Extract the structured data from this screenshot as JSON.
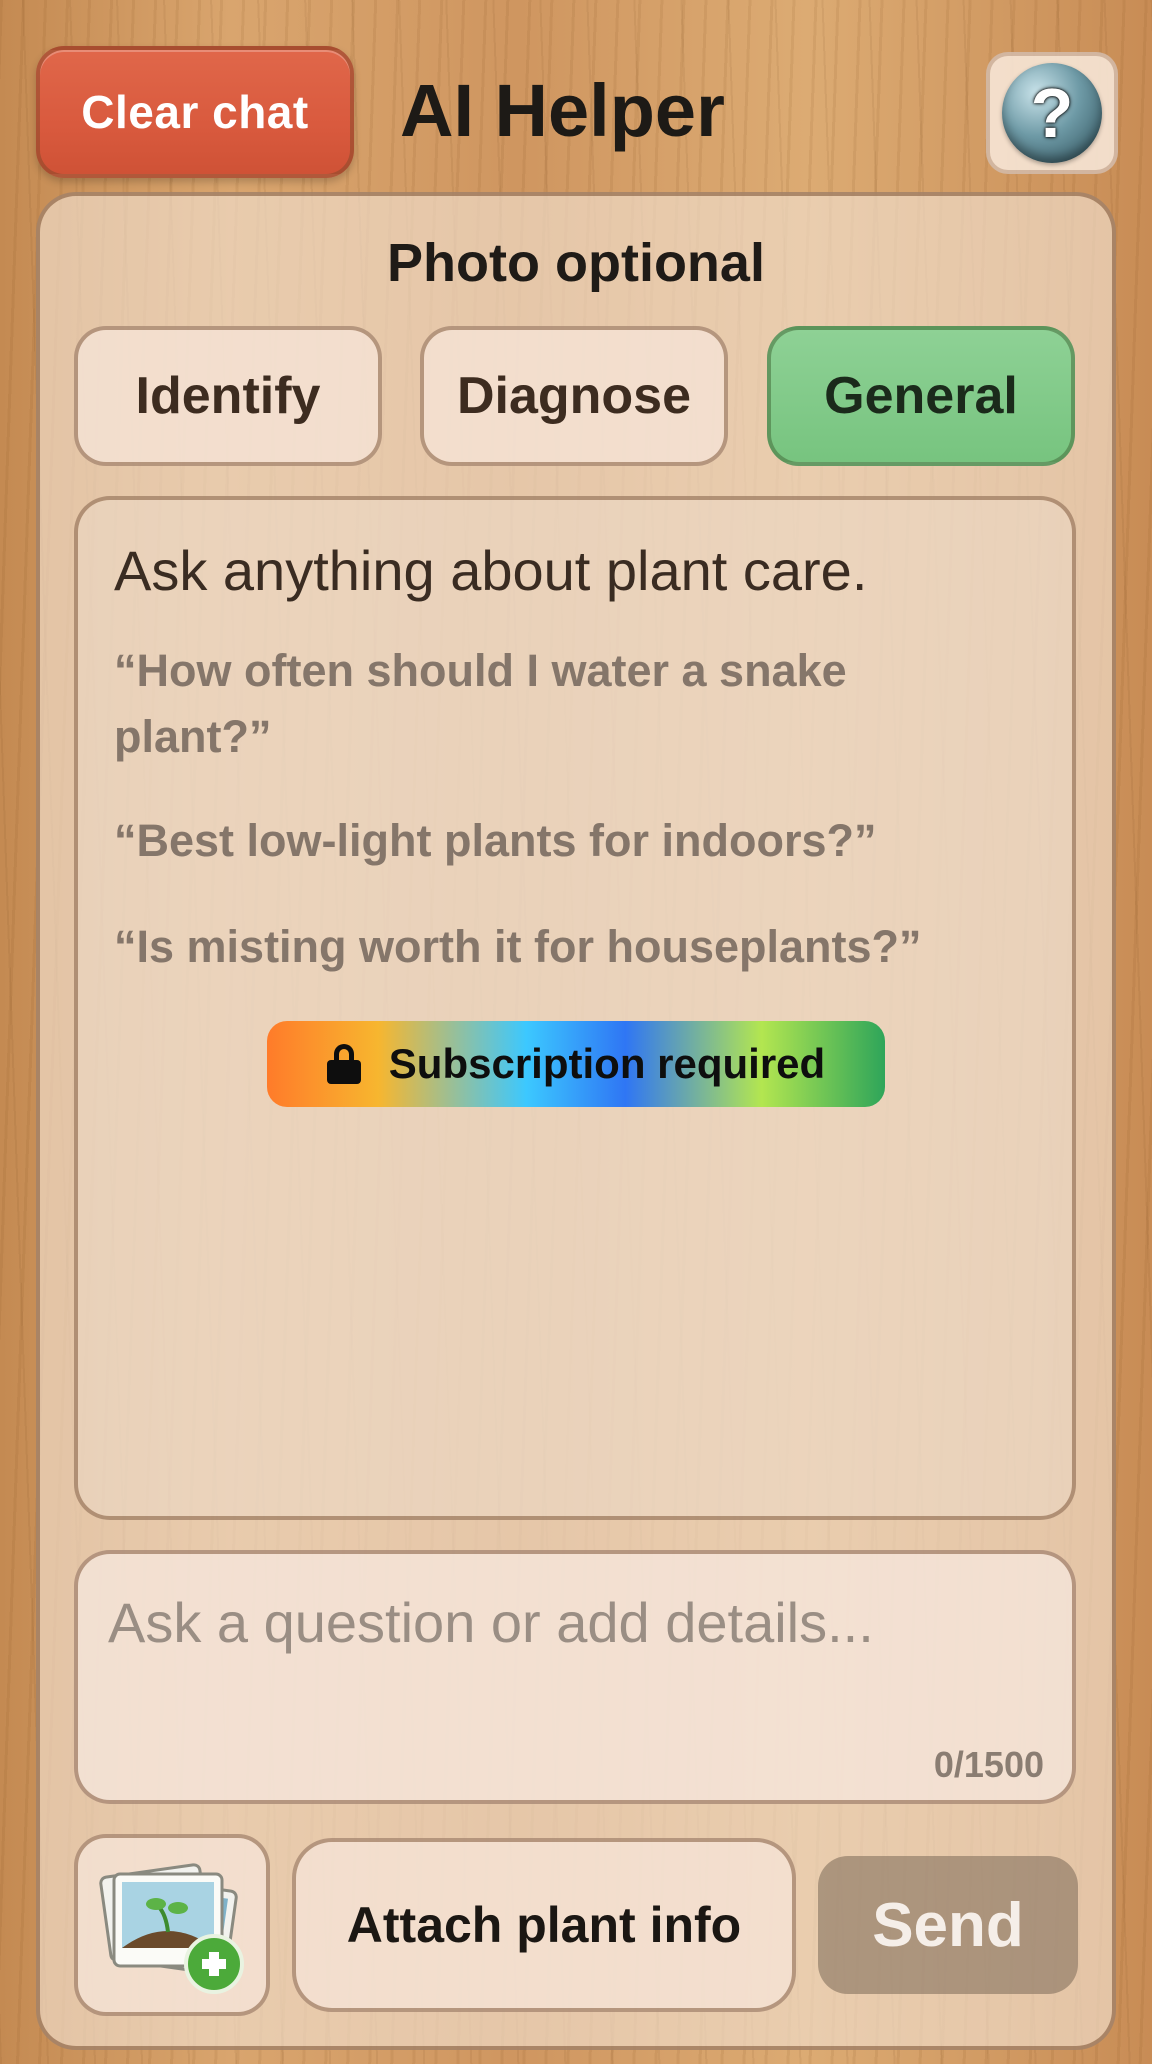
{
  "header": {
    "clear_label": "Clear chat",
    "title": "AI Helper",
    "help_glyph": "?"
  },
  "panel": {
    "photo_hint": "Photo optional",
    "modes": [
      {
        "label": "Identify",
        "active": false
      },
      {
        "label": "Diagnose",
        "active": false
      },
      {
        "label": "General",
        "active": true
      }
    ],
    "chat": {
      "intro": "Ask anything about plant care.",
      "suggestions": [
        "“How often should I water a snake plant?”",
        "“Best low-light plants for indoors?”",
        "“Is misting worth it for houseplants?”"
      ],
      "subscription_badge": "Subscription required"
    },
    "input": {
      "placeholder": "Ask a question or add details...",
      "char_count": "0/1500"
    },
    "actions": {
      "attach_label": "Attach plant info",
      "send_label": "Send"
    }
  },
  "colors": {
    "clear_button": "#d95a3e",
    "active_mode": "#7fc888",
    "send_disabled": "#8c7864"
  },
  "icons": [
    "help-icon",
    "lock-icon",
    "add-photo-icon"
  ]
}
